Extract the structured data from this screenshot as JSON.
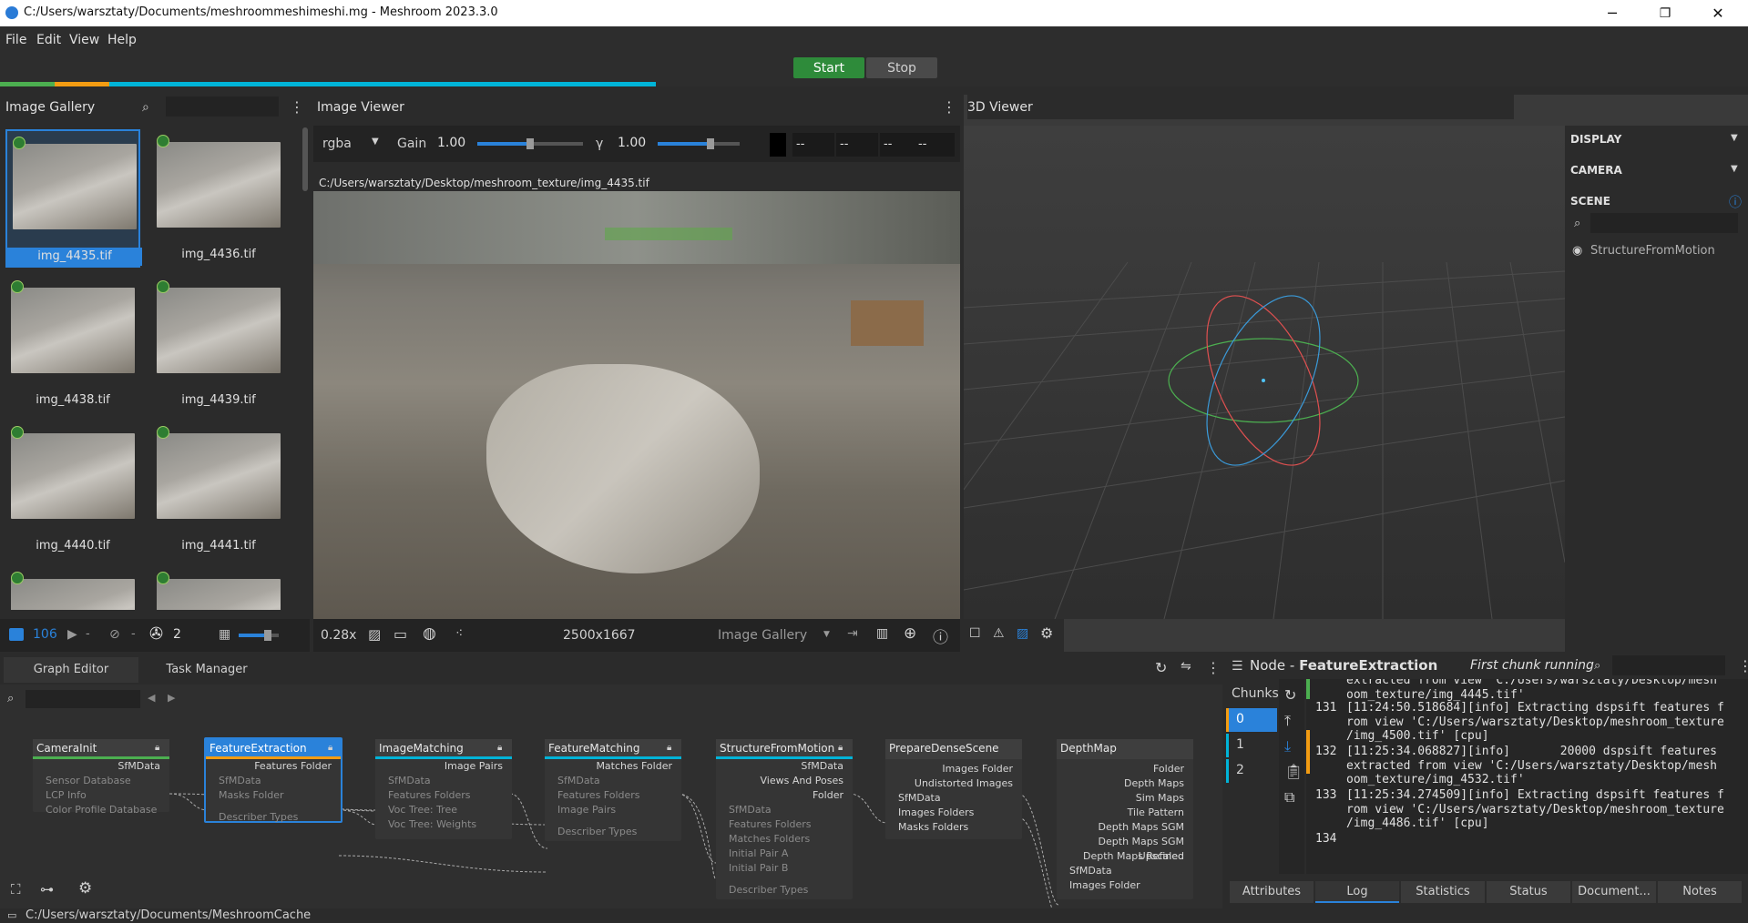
{
  "window": {
    "title": "C:/Users/warsztaty/Documents/meshroommeshimeshi.mg - Meshroom 2023.3.0",
    "minimize": "─",
    "maximize": "❐",
    "close": "✕"
  },
  "menu": [
    "File",
    "Edit",
    "View",
    "Help"
  ],
  "run": {
    "start": "Start",
    "stop": "Stop"
  },
  "gallery": {
    "title": "Image Gallery",
    "images": [
      "img_4435.tif",
      "img_4436.tif",
      "img_4438.tif",
      "img_4439.tif",
      "img_4440.tif",
      "img_4441.tif"
    ],
    "count": "106",
    "cameras": "-",
    "rejected": "-",
    "intrinsics": "2"
  },
  "viewer": {
    "title": "Image Viewer",
    "channel": "rgba",
    "gain_label": "Gain",
    "gain": "1.00",
    "gamma_label": "γ",
    "gamma": "1.00",
    "pixel_values": [
      "--",
      "--",
      "--",
      "--"
    ],
    "path": "C:/Users/warsztaty/Desktop/meshroom_texture/img_4435.tif",
    "zoom": "0.28x",
    "resolution": "2500x1667",
    "source": "Image Gallery"
  },
  "viewer3d": {
    "title": "3D Viewer",
    "sections": {
      "display": "DISPLAY",
      "camera": "CAMERA",
      "scene": "SCENE"
    },
    "scene_item": "StructureFromMotion"
  },
  "graph": {
    "tabs": [
      "Graph Editor",
      "Task Manager"
    ],
    "nodes": [
      {
        "name": "CameraInit",
        "outputs": [
          "SfMData"
        ],
        "inputs": [
          "Sensor Database",
          "LCP Info",
          "Color Profile Database"
        ]
      },
      {
        "name": "FeatureExtraction",
        "outputs": [
          "Features Folder"
        ],
        "inputs": [
          "SfMData",
          "Masks Folder"
        ],
        "extra": [
          "Describer Types"
        ]
      },
      {
        "name": "ImageMatching",
        "outputs": [
          "Image Pairs"
        ],
        "inputs": [
          "SfMData",
          "Features Folders",
          "Voc Tree: Tree",
          "Voc Tree: Weights"
        ]
      },
      {
        "name": "FeatureMatching",
        "outputs": [
          "Matches Folder"
        ],
        "inputs": [
          "SfMData",
          "Features Folders",
          "Image Pairs"
        ],
        "extra": [
          "Describer Types"
        ]
      },
      {
        "name": "StructureFromMotion",
        "outputs": [
          "SfMData",
          "Views And Poses",
          "Folder"
        ],
        "inputs": [
          "SfMData",
          "Features Folders",
          "Matches Folders",
          "Initial Pair A",
          "Initial Pair B"
        ],
        "extra": [
          "Describer Types"
        ]
      },
      {
        "name": "PrepareDenseScene",
        "outputs": [
          "Images Folder",
          "Undistorted Images"
        ],
        "inputs": [
          "SfMData",
          "Images Folders",
          "Masks Folders"
        ]
      },
      {
        "name": "DepthMap",
        "outputs": [
          "Folder",
          "Depth Maps",
          "Sim Maps",
          "Tile Pattern",
          "Depth Maps SGM",
          "Depth Maps SGM Upscaled",
          "Depth Maps Refined"
        ],
        "inputs": [
          "SfMData",
          "Images Folder"
        ]
      }
    ]
  },
  "node_panel": {
    "prefix": "Node - ",
    "name": "FeatureExtraction",
    "status": "First chunk running",
    "chunks_label": "Chunks",
    "chunks": [
      "0",
      "1",
      "2"
    ],
    "log_top": [
      "extracted from view 'C:/Users/warsztaty/Desktop/mesh",
      "oom_texture/img_4445.tif'"
    ],
    "log": [
      {
        "num": "131",
        "lines": [
          "[11:24:50.518684][info] Extracting dspsift features f",
          "rom view 'C:/Users/warsztaty/Desktop/meshroom_texture",
          "/img_4500.tif' [cpu]"
        ]
      },
      {
        "num": "132",
        "lines": [
          "[11:25:34.068827][info]       20000 dspsift features",
          "extracted from view 'C:/Users/warsztaty/Desktop/mesh",
          "oom_texture/img_4532.tif'"
        ]
      },
      {
        "num": "133",
        "lines": [
          "[11:25:34.274509][info] Extracting dspsift features f",
          "rom view 'C:/Users/warsztaty/Desktop/meshroom_texture",
          "/img_4486.tif' [cpu]"
        ]
      },
      {
        "num": "134",
        "lines": [
          ""
        ]
      }
    ],
    "tabs": [
      "Attributes",
      "Log",
      "Statistics",
      "Status",
      "Document...",
      "Notes"
    ]
  },
  "statusbar": {
    "path": "C:/Users/warsztaty/Documents/MeshroomCache"
  },
  "colors": {
    "accent": "#2a82da",
    "start": "#2e8b3a",
    "progress_green": "#4caf50",
    "progress_orange": "#f39c12",
    "progress_cyan": "#00b4d8"
  }
}
